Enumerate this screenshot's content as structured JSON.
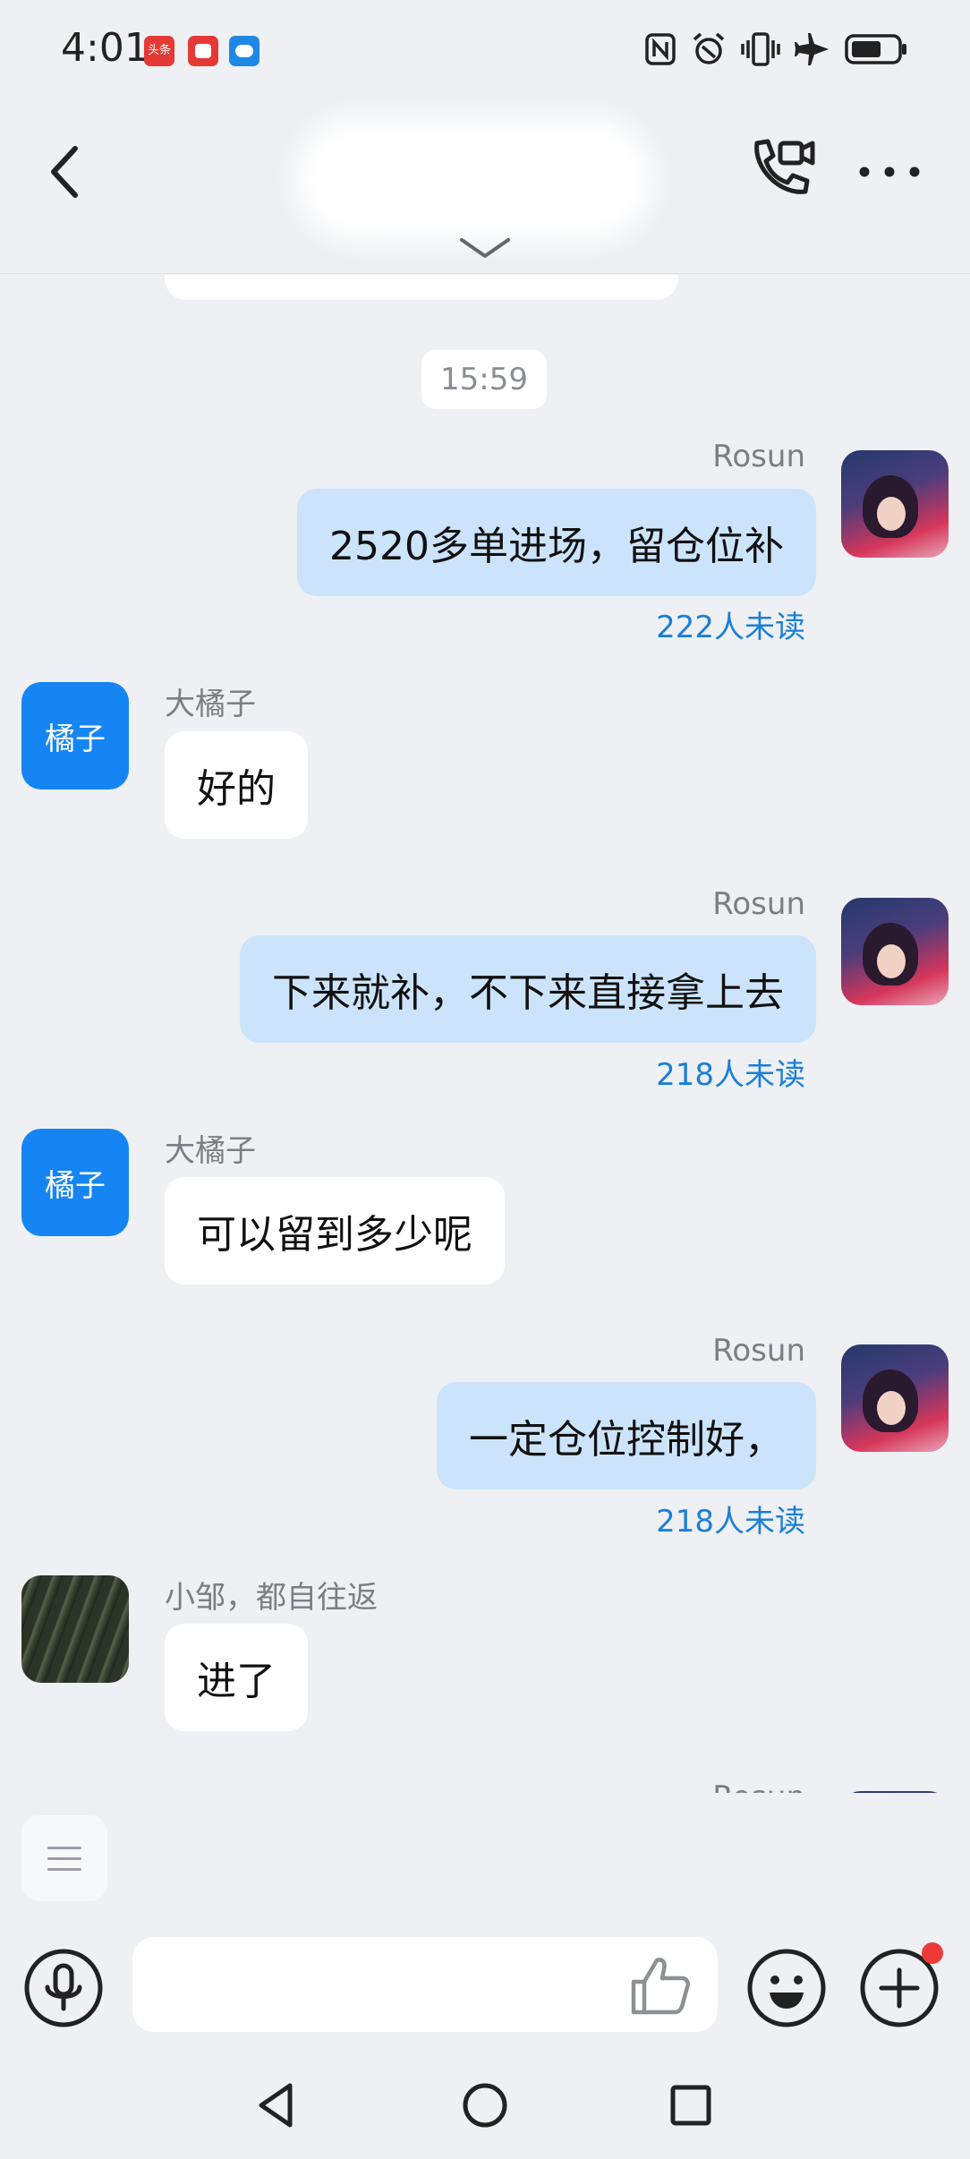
{
  "status_bar": {
    "time": "4:01",
    "notifications": [
      "头条",
      "red-app-icon",
      "blue-app-icon"
    ],
    "icons": [
      "nfc-icon",
      "alarm-icon",
      "vibrate-icon",
      "airplane-icon",
      "battery-icon"
    ]
  },
  "header": {
    "back_icon": "chevron-left-icon",
    "title": "",
    "call_icon": "video-call-icon",
    "more_icon": "more-dots-icon",
    "expand_icon": "chevron-down-icon"
  },
  "time_separator": "15:59",
  "messages": [
    {
      "direction": "out",
      "sender": "Rosun",
      "text": "2520多单进场，留仓位补",
      "read_status": "222人未读"
    },
    {
      "direction": "in",
      "sender": "大橘子",
      "avatar_text": "橘子",
      "text": "好的"
    },
    {
      "direction": "out",
      "sender": "Rosun",
      "text": "下来就补，不下来直接拿上去",
      "read_status": "218人未读"
    },
    {
      "direction": "in",
      "sender": "大橘子",
      "avatar_text": "橘子",
      "text": "可以留到多少呢"
    },
    {
      "direction": "out",
      "sender": "Rosun",
      "text": "一定仓位控制好，",
      "read_status": "218人未读"
    },
    {
      "direction": "in",
      "sender": "小邹，都自往返",
      "text": "进了"
    },
    {
      "direction": "out",
      "sender": "Rosun",
      "text": ""
    }
  ],
  "input_bar": {
    "placeholder": "",
    "mic_icon": "microphone-icon",
    "like_icon": "thumbs-up-icon",
    "emoji_icon": "smiley-icon",
    "plus_icon": "plus-icon"
  },
  "colors": {
    "background": "#eef0f3",
    "outgoing_bubble": "#cce4fb",
    "incoming_bubble": "#ffffff",
    "unread_text": "#1a7fd8",
    "avatar_blue": "#1685f4",
    "badge_red": "#f03a3a"
  }
}
